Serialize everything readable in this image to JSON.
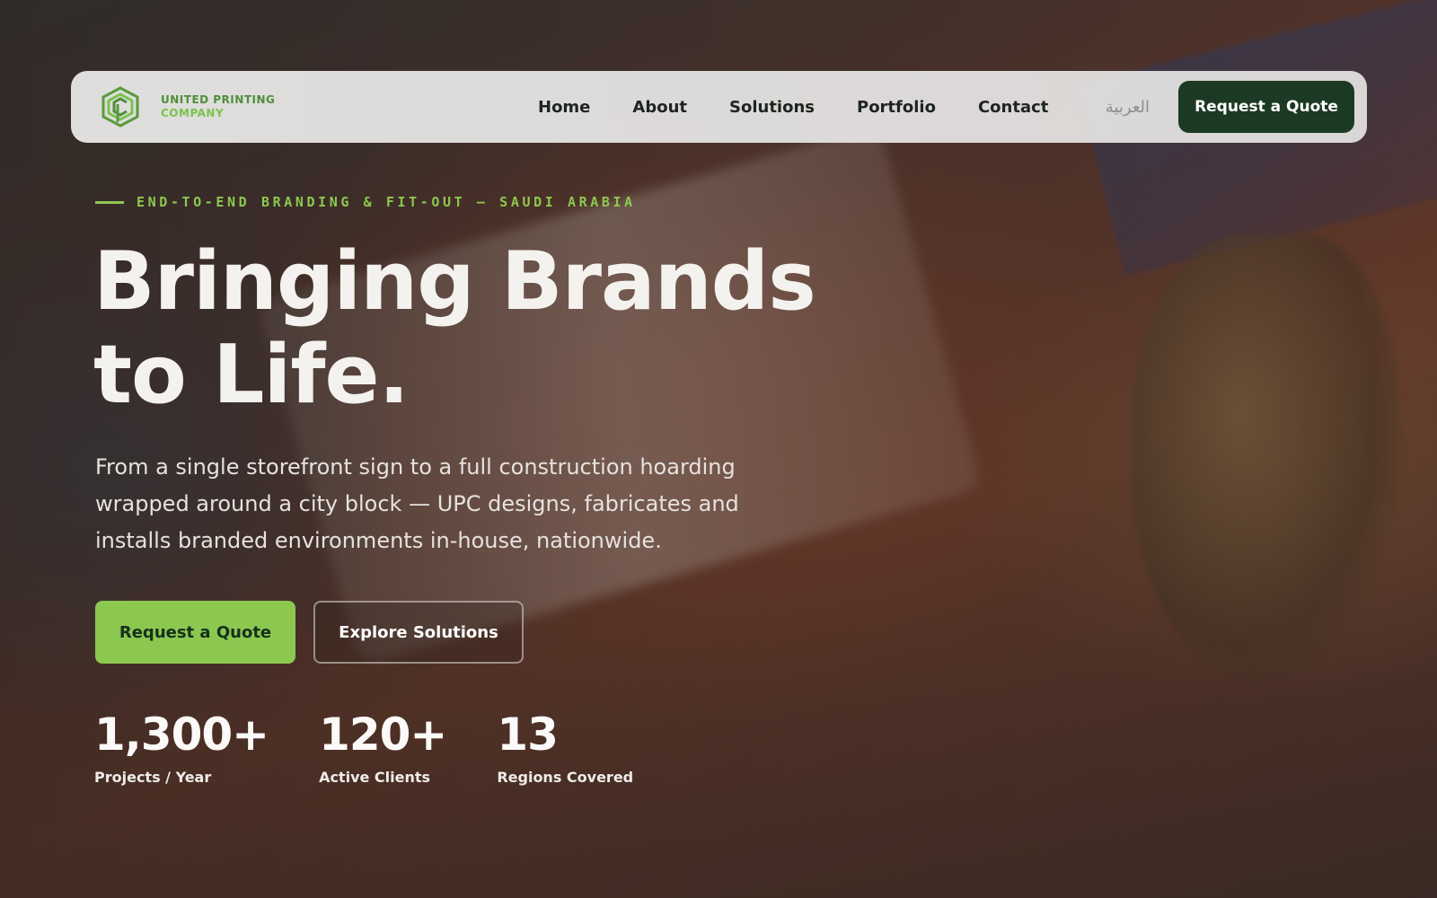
{
  "brand": {
    "name_line1": "UNITED PRINTING",
    "name_line2": "COMPANY",
    "logo_icon": "upc-hexagon-logo",
    "colors": {
      "primary_green": "#8cc850",
      "dark_green": "#1c3a23",
      "logo_green": "#4f8f3a"
    }
  },
  "nav": {
    "links": [
      "Home",
      "About",
      "Solutions",
      "Portfolio",
      "Contact"
    ],
    "language_label": "العربية",
    "quote_button": "Request a Quote"
  },
  "hero": {
    "eyebrow": "END-TO-END BRANDING & FIT-OUT — SAUDI ARABIA",
    "title": "Bringing Brands to Life.",
    "subtitle": "From a single storefront sign to a full construction hoarding wrapped around a city block — UPC designs, fabricates and installs branded environments in-house, nationwide.",
    "primary_cta": "Request a Quote",
    "secondary_cta": "Explore Solutions"
  },
  "stats": [
    {
      "value": "1,300+",
      "label": "Projects / Year"
    },
    {
      "value": "120+",
      "label": "Active Clients"
    },
    {
      "value": "13",
      "label": "Regions Covered"
    }
  ]
}
